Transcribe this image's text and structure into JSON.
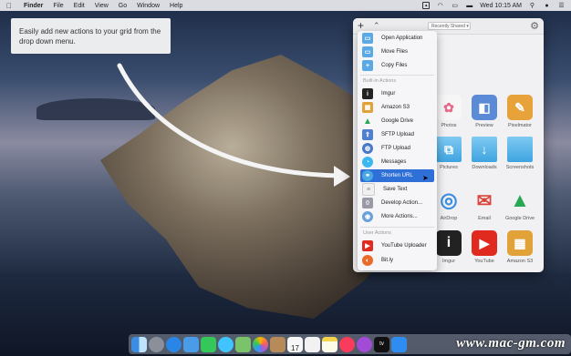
{
  "menubar": {
    "apple": "",
    "app": "Finder",
    "items": [
      "File",
      "Edit",
      "View",
      "Go",
      "Window",
      "Help"
    ],
    "clock": "Wed 10:15 AM"
  },
  "tooltip": {
    "text": "Easily add new actions to your grid from the drop down menu."
  },
  "panel": {
    "toolbar": {
      "plus": "+",
      "collapse": "⌃",
      "select_value": "Recently Shared ▾",
      "gear": "⚙"
    },
    "grid": [
      {
        "label": "Photos",
        "icon": "photos-icon",
        "glyph": "✿",
        "color": "#f6f6f6"
      },
      {
        "label": "Preview",
        "icon": "preview-icon",
        "glyph": "◧",
        "color": "#5b8bd6"
      },
      {
        "label": "Pixelmator",
        "icon": "pixelmator-icon",
        "glyph": "✎",
        "color": "#e8a23a"
      },
      {
        "label": "Pictures",
        "icon": "pictures-folder-icon",
        "glyph": "⧉",
        "color": "#4aa8e2"
      },
      {
        "label": "Downloads",
        "icon": "downloads-folder-icon",
        "glyph": "↓",
        "color": "#4aa8e2"
      },
      {
        "label": "Screenshots",
        "icon": "screenshots-folder-icon",
        "glyph": "",
        "color": "#4aa8e2"
      },
      {
        "label": "AirDrop",
        "icon": "airdrop-icon",
        "glyph": "◎",
        "color": "#3a8de0"
      },
      {
        "label": "Email",
        "icon": "email-icon",
        "glyph": "✉",
        "color": "#d9433b"
      },
      {
        "label": "Google Drive",
        "icon": "google-drive-icon",
        "glyph": "▲",
        "color": "#28a854"
      },
      {
        "label": "Imgur",
        "icon": "imgur-icon",
        "glyph": "i",
        "color": "#222222"
      },
      {
        "label": "YouTube",
        "icon": "youtube-icon",
        "glyph": "▶",
        "color": "#e02a20"
      },
      {
        "label": "Amazon S3",
        "icon": "amazon-s3-icon",
        "glyph": "▦",
        "color": "#e2a23a"
      }
    ]
  },
  "menu": {
    "top_items": [
      {
        "label": "Open Application",
        "icon": "open-application-icon",
        "glyph": "▭",
        "color": "#5aa9e6"
      },
      {
        "label": "Move Files",
        "icon": "move-files-icon",
        "glyph": "▭",
        "color": "#5aa9e6"
      },
      {
        "label": "Copy Files",
        "icon": "copy-files-icon",
        "glyph": "+",
        "color": "#5aa9e6"
      }
    ],
    "builtin_header": "Built-in Actions",
    "builtin_items": [
      {
        "label": "Imgur",
        "icon": "imgur-icon",
        "glyph": "i",
        "color": "#222222"
      },
      {
        "label": "Amazon S3",
        "icon": "amazon-s3-icon",
        "glyph": "▦",
        "color": "#e2a23a"
      },
      {
        "label": "Google Drive",
        "icon": "google-drive-icon",
        "glyph": "▲",
        "color": "#28a854"
      },
      {
        "label": "SFTP Upload",
        "icon": "sftp-upload-icon",
        "glyph": "⇪",
        "color": "#4f7fd0"
      },
      {
        "label": "FTP Upload",
        "icon": "ftp-upload-icon",
        "glyph": "◍",
        "color": "#4a78c8"
      },
      {
        "label": "Messages",
        "icon": "messages-icon",
        "glyph": "◔",
        "color": "#3bb8f0"
      },
      {
        "label": "Shorten URL",
        "icon": "shorten-url-icon",
        "glyph": "⚭",
        "color": "#4aa8e2"
      },
      {
        "label": "Save Text",
        "icon": "save-text-icon",
        "glyph": "≡",
        "color": "#f0f0f0"
      },
      {
        "label": "Develop Action...",
        "icon": "develop-action-icon",
        "glyph": "{}",
        "color": "#9a9aa6"
      },
      {
        "label": "More Actions...",
        "icon": "more-actions-icon",
        "glyph": "◉",
        "color": "#6aa0d8"
      }
    ],
    "user_header": "User Actions",
    "user_items": [
      {
        "label": "YouTube Uploader",
        "icon": "youtube-uploader-icon",
        "glyph": "▶",
        "color": "#e02a20"
      },
      {
        "label": "Bit.ly",
        "icon": "bitly-icon",
        "glyph": "◐",
        "color": "#eb6a2a"
      }
    ],
    "selected": "Shorten URL"
  },
  "dock": {
    "apps": [
      {
        "name": "finder-icon",
        "color": "#3a8de0"
      },
      {
        "name": "launchpad-icon",
        "color": "#8a8f9a"
      },
      {
        "name": "safari-icon",
        "color": "#2a86e6"
      },
      {
        "name": "mail-stamp-icon",
        "color": "#4a9be8"
      },
      {
        "name": "facetime-icon",
        "color": "#34c759"
      },
      {
        "name": "messages-icon",
        "color": "#40c4ff"
      },
      {
        "name": "maps-icon",
        "color": "#7ac36a"
      },
      {
        "name": "photos-icon",
        "color": "#f3f3f3"
      },
      {
        "name": "contacts-icon",
        "color": "#b78a5a"
      },
      {
        "name": "calendar-icon",
        "color": "#f7f7f7"
      },
      {
        "name": "reminders-icon",
        "color": "#f2f2f2"
      },
      {
        "name": "notes-icon",
        "color": "#f5d34a"
      },
      {
        "name": "music-icon",
        "color": "#fa3c5c"
      },
      {
        "name": "podcasts-icon",
        "color": "#a14bd6"
      },
      {
        "name": "tv-icon",
        "color": "#111111"
      },
      {
        "name": "app-store-icon",
        "color": "#2f8cf0"
      }
    ],
    "calendar_day": "17",
    "tv_label": "tv"
  },
  "watermark": "www.mac-gm.com"
}
